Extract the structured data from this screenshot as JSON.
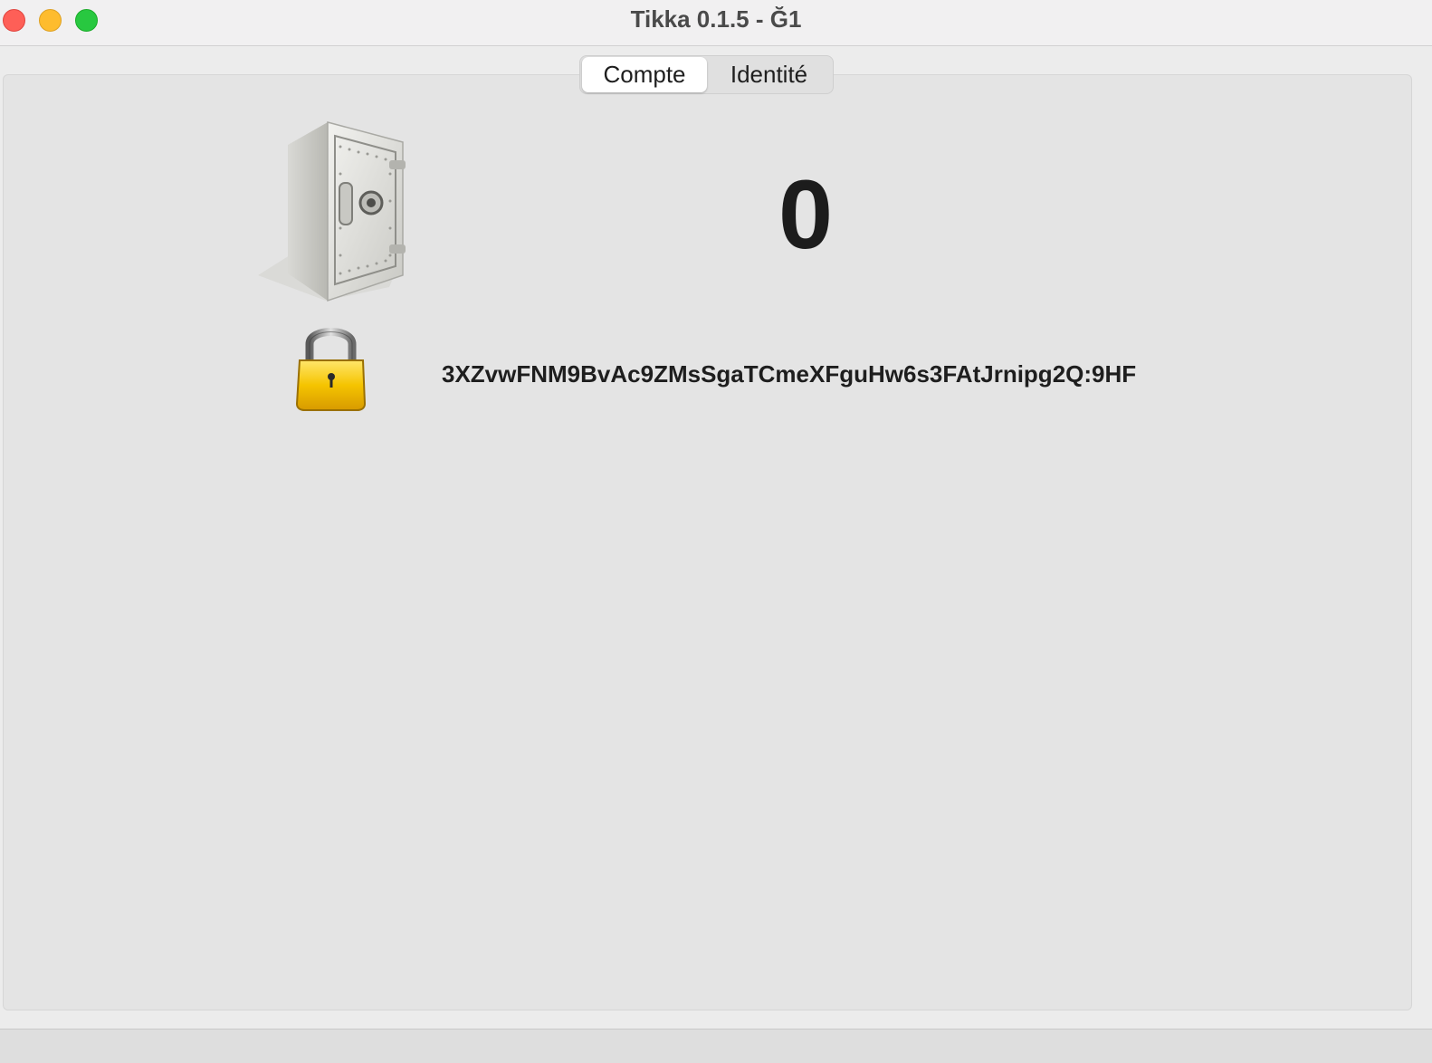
{
  "window": {
    "title": "Tikka 0.1.5 - Ğ1"
  },
  "tabs": [
    {
      "label": "Compte",
      "active": true
    },
    {
      "label": "Identité",
      "active": false
    }
  ],
  "account": {
    "balance": "0",
    "public_key": "3XZvwFNM9BvAc9ZMsSgaTCmeXFguHw6s3FAtJrnipg2Q:9HF"
  },
  "icons": {
    "wallet": "safe-icon",
    "lock": "lock-icon"
  },
  "colors": {
    "close": "#fe5f57",
    "minimize": "#febc2e",
    "maximize": "#28c840",
    "lock_body": "#f5c400"
  }
}
